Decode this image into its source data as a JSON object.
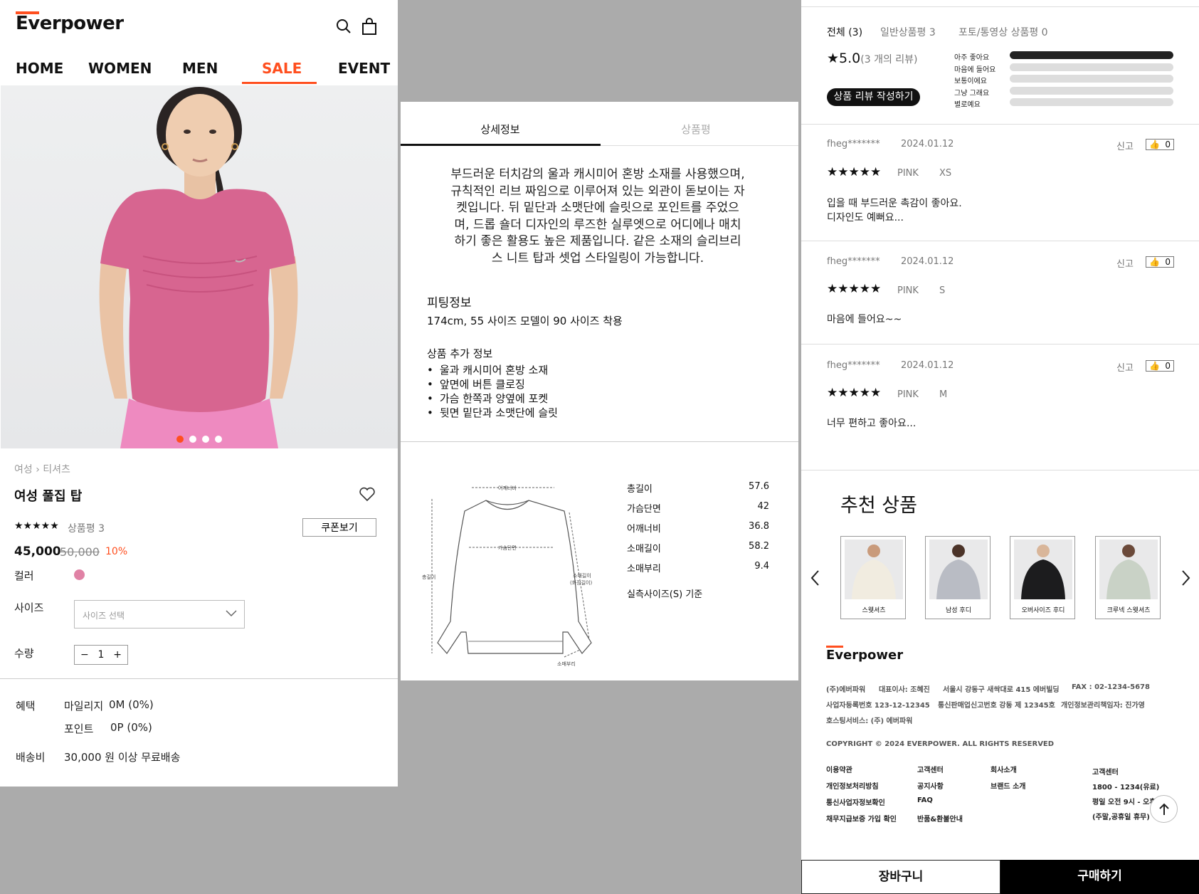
{
  "header": {
    "logo": "Everpower",
    "nav": [
      "HOME",
      "WOMEN",
      "MEN",
      "SALE",
      "EVENT"
    ],
    "active_nav": "SALE"
  },
  "product": {
    "breadcrumb": [
      "여성",
      "티셔츠"
    ],
    "title": "여성 풀집 탑",
    "stars": "★★★★★",
    "review_label": "상품평 3",
    "coupon_label": "쿠폰보기",
    "price": "45,000",
    "original_price": "50,000",
    "discount": "10%",
    "color_label": "컬러",
    "color_hex": "#e082a5",
    "size_label": "사이즈",
    "size_placeholder": "사이즈 선택",
    "qty_label": "수량",
    "qty_value": "1",
    "image_count": 4,
    "active_image": 1,
    "benefits_label": "혜택",
    "mileage": "마일리지",
    "mileage_value": "0M (0%)",
    "points": "포인트",
    "points_value": "0P (0%)",
    "shipping_label": "배송비",
    "shipping_value": "30,000 원 이상 무료배송"
  },
  "detail": {
    "tabs": [
      "상세정보",
      "상품평"
    ],
    "description": "부드러운 터치감의 울과 캐시미어 혼방 소재를 사용했으며, 규칙적인 리브 짜임으로 이루어져 있는 외관이 돋보이는 자켓입니다. 뒤 밑단과 소맷단에 슬릿으로 포인트를 주었으며, 드롭 숄더 디자인의 루즈한 실루엣으로 어디에나 매치하기 좋은 활용도 높은 제품입니다. 같은 소재의 슬리브리스 니트 탑과 셋업 스타일링이 가능합니다.",
    "fitting_title": "피팅정보",
    "fitting_text": "174cm, 55 사이즈 모델이 90 사이즈 착용",
    "extra_title": "상품 추가 정보",
    "extra_items": [
      "울과 캐시미어 혼방 소재",
      "앞면에 버튼 클로징",
      "가슴 한쪽과 양옆에 포켓",
      "뒷면 밑단과 소맷단에 슬릿"
    ],
    "diagram_labels": {
      "shoulder": "어깨너비",
      "chest": "가슴단면",
      "length": "총길이",
      "sleeve": "소매길이",
      "sleeve_sub": "(화장길이)",
      "cuff": "소매부리"
    },
    "size_rows": [
      {
        "name": "총길이",
        "value": "57.6"
      },
      {
        "name": "가슴단면",
        "value": "42"
      },
      {
        "name": "어깨너비",
        "value": "36.8"
      },
      {
        "name": "소매길이",
        "value": "58.2"
      },
      {
        "name": "소매부리",
        "value": "9.4"
      }
    ],
    "size_note": "실측사이즈(S) 기준"
  },
  "reviews": {
    "tabs": [
      "전체 (3)",
      "일반상품평 3",
      "포토/통영상 상품평 0"
    ],
    "score": "★5.0",
    "score_count": "(3 개의 리뷰)",
    "write_button": "상품 리뷰 작성하기",
    "rating_bars": [
      {
        "label": "아주 좋아요",
        "fill": 1.0
      },
      {
        "label": "마음에 들어요",
        "fill": 0
      },
      {
        "label": "보통이에요",
        "fill": 0
      },
      {
        "label": "그냥 그래요",
        "fill": 0
      },
      {
        "label": "별로예요",
        "fill": 0
      }
    ],
    "report_label": "신고",
    "items": [
      {
        "user": "fheg*******",
        "date": "2024.01.12",
        "likes": "0",
        "stars": "★★★★★",
        "color": "PINK",
        "size": "XS",
        "text1": "입을 때 부드러운 촉감이 좋아요.",
        "text2": "디자인도 예뻐요..."
      },
      {
        "user": "fheg*******",
        "date": "2024.01.12",
        "likes": "0",
        "stars": "★★★★★",
        "color": "PINK",
        "size": "S",
        "text1": "마음에 들어요~~",
        "text2": ""
      },
      {
        "user": "fheg*******",
        "date": "2024.01.12",
        "likes": "0",
        "stars": "★★★★★",
        "color": "PINK",
        "size": "M",
        "text1": "너무 편하고 좋아요...",
        "text2": ""
      }
    ]
  },
  "recommend": {
    "title": "추천 상품",
    "items": [
      {
        "name": "스웻셔츠",
        "color": "#f1ece0"
      },
      {
        "name": "남성 후디",
        "color": "#b9bcc4"
      },
      {
        "name": "오버사이즈 후디",
        "color": "#1c1c1e"
      },
      {
        "name": "크루넥 스웻셔츠",
        "color": "#c9d2c6"
      }
    ]
  },
  "footer": {
    "logo": "Everpower",
    "company": "(주)에버파워",
    "ceo": "대표이사: 조혜진",
    "address": "서울시 강동구 새싹대로 415 에버빌딩",
    "fax": "FAX : 02-1234-5678",
    "biz_no": "사업자등록번호 123-12-12345",
    "telecom_no": "통신판매업신고번호 강동 제 12345호",
    "privacy_officer": "개인정보관리책임자: 진가영",
    "hosting": "호스팅서비스: (주) 에버파워",
    "copyright": "COPYRIGHT © 2024 EVERPOWER. ALL RIGHTS RESERVED",
    "links_col1": [
      "이용약관",
      "개인정보처리방침",
      "통신사업자정보확인",
      "채무지급보증 가입 확인"
    ],
    "links_col2": [
      "고객센터",
      "공지사항",
      "FAQ",
      "반품&환불안내"
    ],
    "links_col3": [
      "회사소개",
      "브랜드 소개"
    ],
    "cs_title": "고객센터",
    "cs_phone": "1800 - 1234(유료)",
    "cs_hours": "평일 오전 9시 - 오후",
    "cs_holiday": "(주말,공휴일 휴무)"
  },
  "actions": {
    "cart": "장바구니",
    "buy": "구매하기"
  }
}
